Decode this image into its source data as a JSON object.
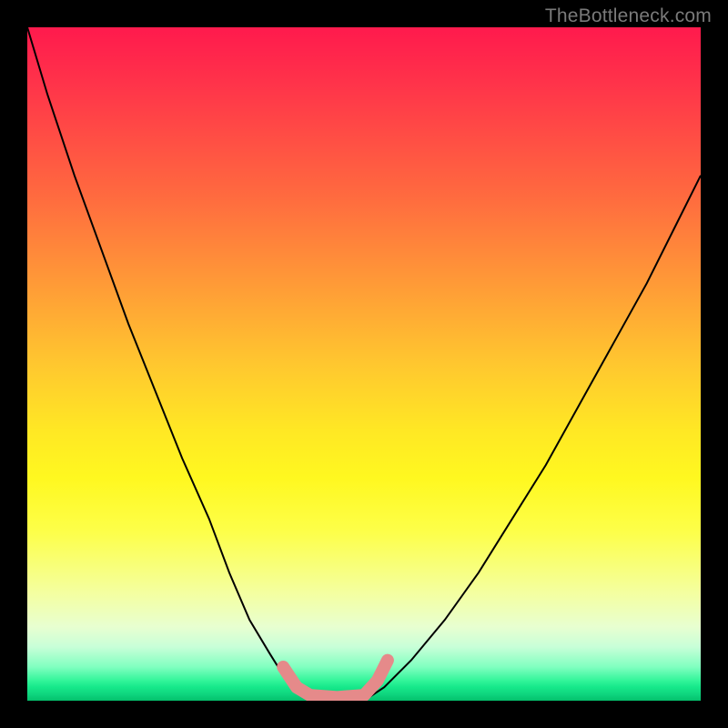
{
  "watermark": {
    "text": "TheBottleneck.com"
  },
  "chart_data": {
    "type": "line",
    "title": "",
    "xlabel": "",
    "ylabel": "",
    "xlim": [
      0,
      100
    ],
    "ylim": [
      0,
      100
    ],
    "grid": false,
    "legend": false,
    "background_gradient": {
      "top": "#ff1a4d",
      "mid": "#ffe824",
      "bottom": "#04c06c"
    },
    "series": [
      {
        "name": "left-curve",
        "x": [
          0,
          3,
          7,
          11,
          15,
          19,
          23,
          27,
          30,
          33,
          36,
          38.5,
          40.5,
          42
        ],
        "y": [
          100,
          90,
          78,
          67,
          56,
          46,
          36,
          27,
          19,
          12,
          7,
          3,
          1,
          0
        ],
        "stroke": "#000000"
      },
      {
        "name": "right-curve",
        "x": [
          50,
          53,
          57,
          62,
          67,
          72,
          77,
          82,
          87,
          92,
          96,
          100
        ],
        "y": [
          0,
          2,
          6,
          12,
          19,
          27,
          35,
          44,
          53,
          62,
          70,
          78
        ],
        "stroke": "#000000"
      },
      {
        "name": "bottom-marker",
        "x": [
          38,
          40,
          42,
          46,
          50,
          52,
          53.5
        ],
        "y": [
          5,
          2,
          0.8,
          0.5,
          0.8,
          3,
          6
        ],
        "stroke": "#e58a8a"
      }
    ],
    "annotations": []
  }
}
